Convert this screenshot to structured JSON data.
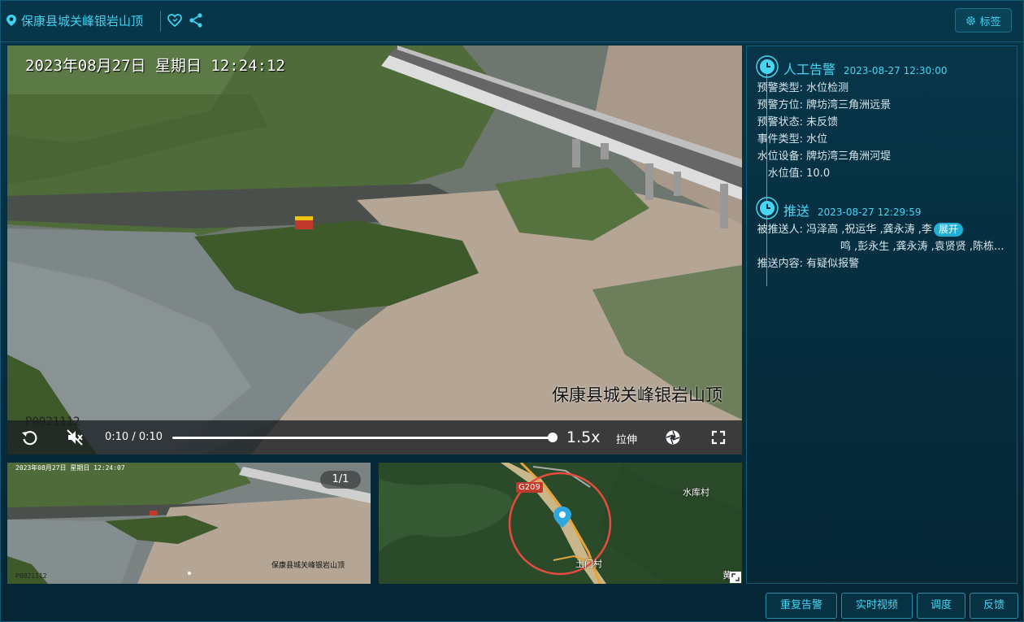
{
  "header": {
    "title": "保康县城关峰银岩山顶",
    "tag_button": "标签"
  },
  "video": {
    "timestamp": "2023年08月27日  星期日  12:24:12",
    "overlay_location": "保康县城关峰银岩山顶",
    "camera_id": "P0921112",
    "current_time": "0:10",
    "time_separator": "/",
    "duration": "0:10",
    "progress": 1.0,
    "speed": "1.5x",
    "stretch_label": "拉伸"
  },
  "thumbnail": {
    "timestamp": "2023年08月27日  星期日  12:24:07",
    "overlay_location": "保康县城关峰银岩山顶",
    "camera_id": "P0921112",
    "pager": "1/1"
  },
  "map": {
    "labels": {
      "reservoir_village": "水库村",
      "tumen_village": "土门村",
      "road": "G209",
      "edge": "黄"
    }
  },
  "timeline": [
    {
      "title": "人工告警",
      "time": "2023-08-27 12:30:00",
      "fields": [
        {
          "key": "预警类型:",
          "value": "水位检测"
        },
        {
          "key": "预警方位:",
          "value": "牌坊湾三角洲远景"
        },
        {
          "key": "预警状态:",
          "value": "未反馈"
        },
        {
          "key": "事件类型:",
          "value": "水位"
        },
        {
          "key": "水位设备:",
          "value": "牌坊湾三角洲河堤"
        },
        {
          "key": "水位值:",
          "value": "10.0"
        }
      ]
    },
    {
      "title": "推送",
      "time": "2023-08-27 12:29:59",
      "recipients_key": "被推送人:",
      "recipients_line1": "冯泽高 ,祝运华 ,龚永涛 ,李",
      "expand_label": "展开",
      "recipients_line2": "鸣 ,彭永生 ,龚永涛 ,袁贤贤 ,陈栋...",
      "content_key": "推送内容:",
      "content_value": "有疑似报警"
    }
  ],
  "footer": {
    "buttons": [
      "重复告警",
      "实时视频",
      "调度",
      "反馈"
    ]
  },
  "colors": {
    "accent": "#3fd1ee",
    "background": "#062a3a",
    "alert_circle": "#e74c3c"
  }
}
